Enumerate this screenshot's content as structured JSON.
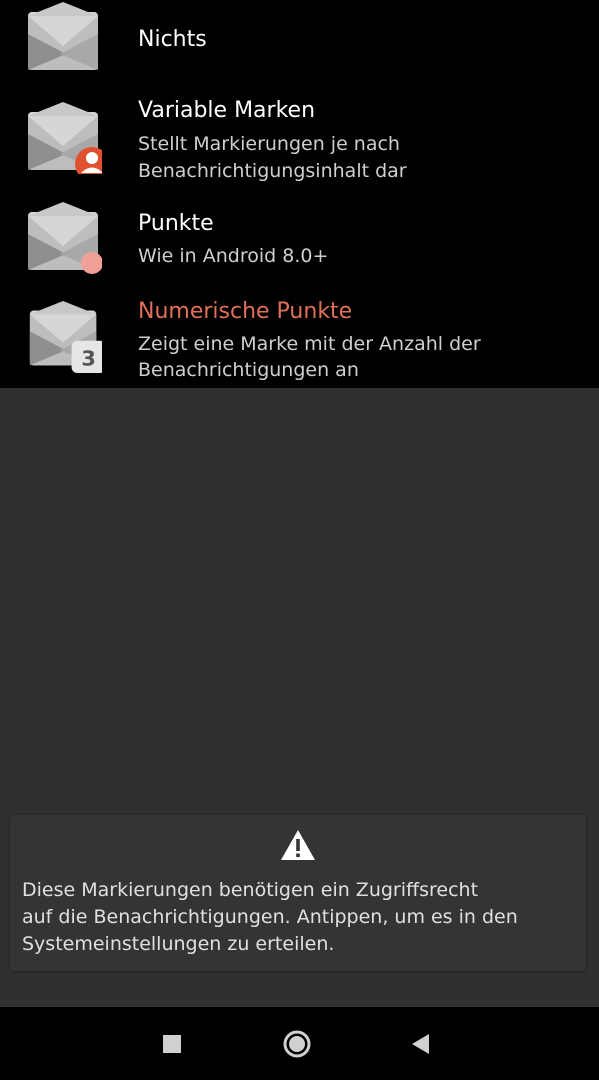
{
  "options": [
    {
      "title": "Nichts",
      "subtitle": "",
      "icon": "mail-icon"
    },
    {
      "title": "Variable Marken",
      "subtitle_line1": "Stellt Markierungen je nach",
      "subtitle_line2": "Benachrichtigungsinhalt dar",
      "icon": "mail-person-badge-icon"
    },
    {
      "title": "Punkte",
      "subtitle_line1": "Wie in Android 8.0+",
      "icon": "mail-dot-badge-icon"
    },
    {
      "title": "Numerische Punkte",
      "subtitle_line1": "Zeigt eine Marke mit der Anzahl der",
      "subtitle_line2": "Benachrichtigungen an",
      "icon": "mail-number-badge-icon",
      "badge_number": "3",
      "selected": true
    }
  ],
  "notice": {
    "icon": "warning-icon",
    "line1": "Diese Markierungen benötigen ein Zugriffsrecht",
    "line2": "auf die Benachrichtigungen. Antippen, um es in den",
    "line3": "Systemeinstellungen zu erteilen."
  },
  "navbar": {
    "recents_icon": "square-icon",
    "home_icon": "circle-icon",
    "back_icon": "triangle-back-icon"
  },
  "colors": {
    "accent": "#e1705a",
    "badge_person": "#e0522f",
    "badge_dot": "#f0a097"
  }
}
